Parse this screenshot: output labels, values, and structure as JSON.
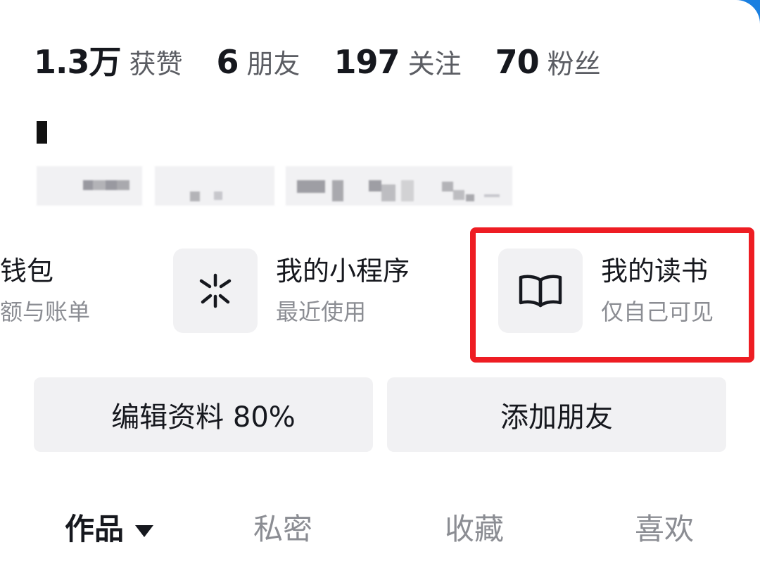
{
  "stats": [
    {
      "value": "1.3万",
      "label": "获赞"
    },
    {
      "value": "6",
      "label": "朋友"
    },
    {
      "value": "197",
      "label": "关注"
    },
    {
      "value": "70",
      "label": "粉丝"
    }
  ],
  "services": {
    "wallet": {
      "title": "钱包",
      "subtitle": "余额与账单",
      "title_visible": "钱包",
      "subtitle_visible": "额与账单"
    },
    "mini_programs": {
      "title": "我的小程序",
      "subtitle": "最近使用",
      "icon": "sparkle-asterisk-icon"
    },
    "reading": {
      "title": "我的读书",
      "subtitle": "仅自己可见",
      "icon": "open-book-icon"
    }
  },
  "actions": {
    "edit_profile": "编辑资料 80%",
    "add_friends": "添加朋友"
  },
  "tabs": [
    {
      "label": "作品",
      "active": true
    },
    {
      "label": "私密",
      "active": false
    },
    {
      "label": "收藏",
      "active": false
    },
    {
      "label": "喜欢",
      "active": false
    }
  ],
  "colors": {
    "highlight": "#ee1d23",
    "header_bg": "#1a7fe0",
    "tile_bg": "#f1f1f3"
  }
}
